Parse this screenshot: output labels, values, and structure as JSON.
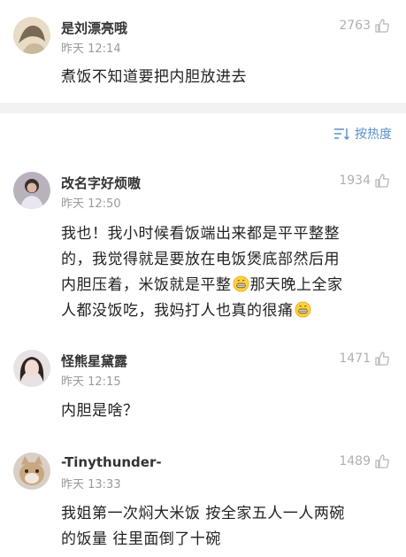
{
  "comments": [
    {
      "username": "是刘漂亮哦",
      "time": "昨天 12:14",
      "likes": "2763",
      "lines": [
        "煮饭不知道要把内胆放进去"
      ]
    },
    {
      "username": "改名字好烦嗷",
      "time": "昨天 12:50",
      "likes": "1934",
      "lines": [
        "我也！我小时候看饭端出来都是平平整整",
        "的，我觉得就是要放在电饭煲底部然后用",
        "内胆压着，米饭就是平整",
        "那天晚上全家",
        "人都没饭吃，我妈打人也真的很痛"
      ]
    },
    {
      "username": "怪熊星黛露",
      "time": "昨天 12:15",
      "likes": "1471",
      "lines": [
        "内胆是啥？"
      ]
    },
    {
      "username": "-Tinythunder-",
      "time": "昨天 13:33",
      "likes": "1489",
      "lines": [
        "我姐第一次焖大米饭 按全家五人一人两碗",
        "的饭量 往里面倒了十碗"
      ]
    }
  ],
  "sort": {
    "label": "按热度",
    "icon": "sort-icon"
  },
  "colors": {
    "accent": "#5b8fc7",
    "muted": "#9a9a9a",
    "band": "#f2f2f2"
  }
}
